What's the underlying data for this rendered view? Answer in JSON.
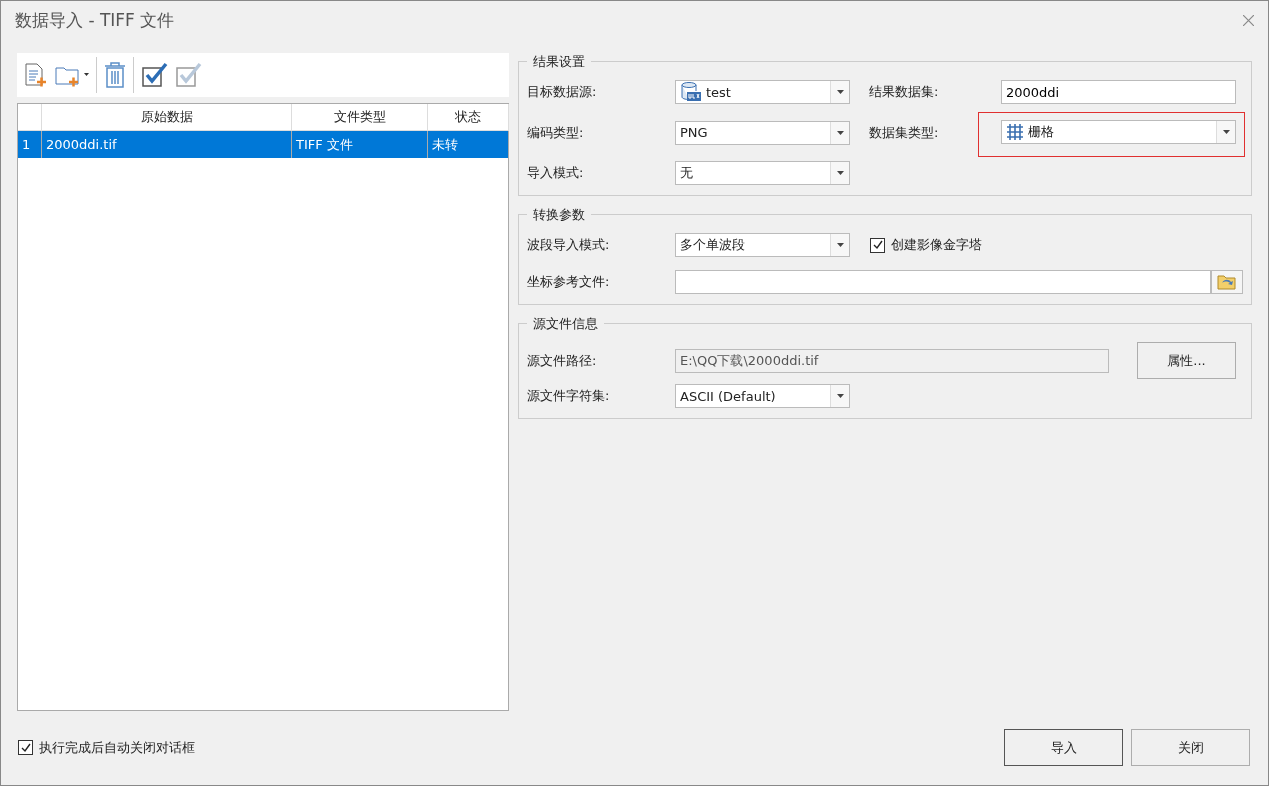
{
  "window": {
    "title": "数据导入 - TIFF 文件"
  },
  "table": {
    "columns": [
      "原始数据",
      "文件类型",
      "状态"
    ],
    "rows": [
      {
        "index": "1",
        "cells": [
          "2000ddi.tif",
          "TIFF 文件",
          "未转"
        ],
        "selected": true
      }
    ]
  },
  "result_settings": {
    "title": "结果设置",
    "fields": [
      {
        "kind": "combo",
        "label": "目标数据源:",
        "value": "test",
        "highlighted": false
      },
      {
        "kind": "text",
        "label": "结果数据集:",
        "value": "2000ddi",
        "highlighted": false
      },
      {
        "kind": "combo",
        "label": "编码类型:",
        "value": "PNG",
        "highlighted": false
      },
      {
        "kind": "combo",
        "label": "数据集类型:",
        "value": "栅格",
        "highlighted": true
      },
      {
        "kind": "combo",
        "label": "导入模式:",
        "value": "无",
        "highlighted": false
      }
    ]
  },
  "conversion": {
    "title": "转换参数",
    "band_mode": {
      "label": "波段导入模式:",
      "value": "多个单波段"
    },
    "pyramid": {
      "label": "创建影像金字塔",
      "checked": true
    },
    "coord_file": {
      "label": "坐标参考文件:"
    }
  },
  "source_info": {
    "title": "源文件信息",
    "path": {
      "label": "源文件路径:",
      "value": "E:\\QQ下载\\2000ddi.tif"
    },
    "properties_button": "属性...",
    "charset": {
      "label": "源文件字符集:",
      "value": "ASCII (Default)"
    }
  },
  "footer": {
    "auto_close": {
      "label": "执行完成后自动关闭对话框",
      "checked": true
    },
    "buttons": [
      {
        "label": "导入",
        "default": true
      },
      {
        "label": "关闭",
        "default": false
      }
    ]
  }
}
